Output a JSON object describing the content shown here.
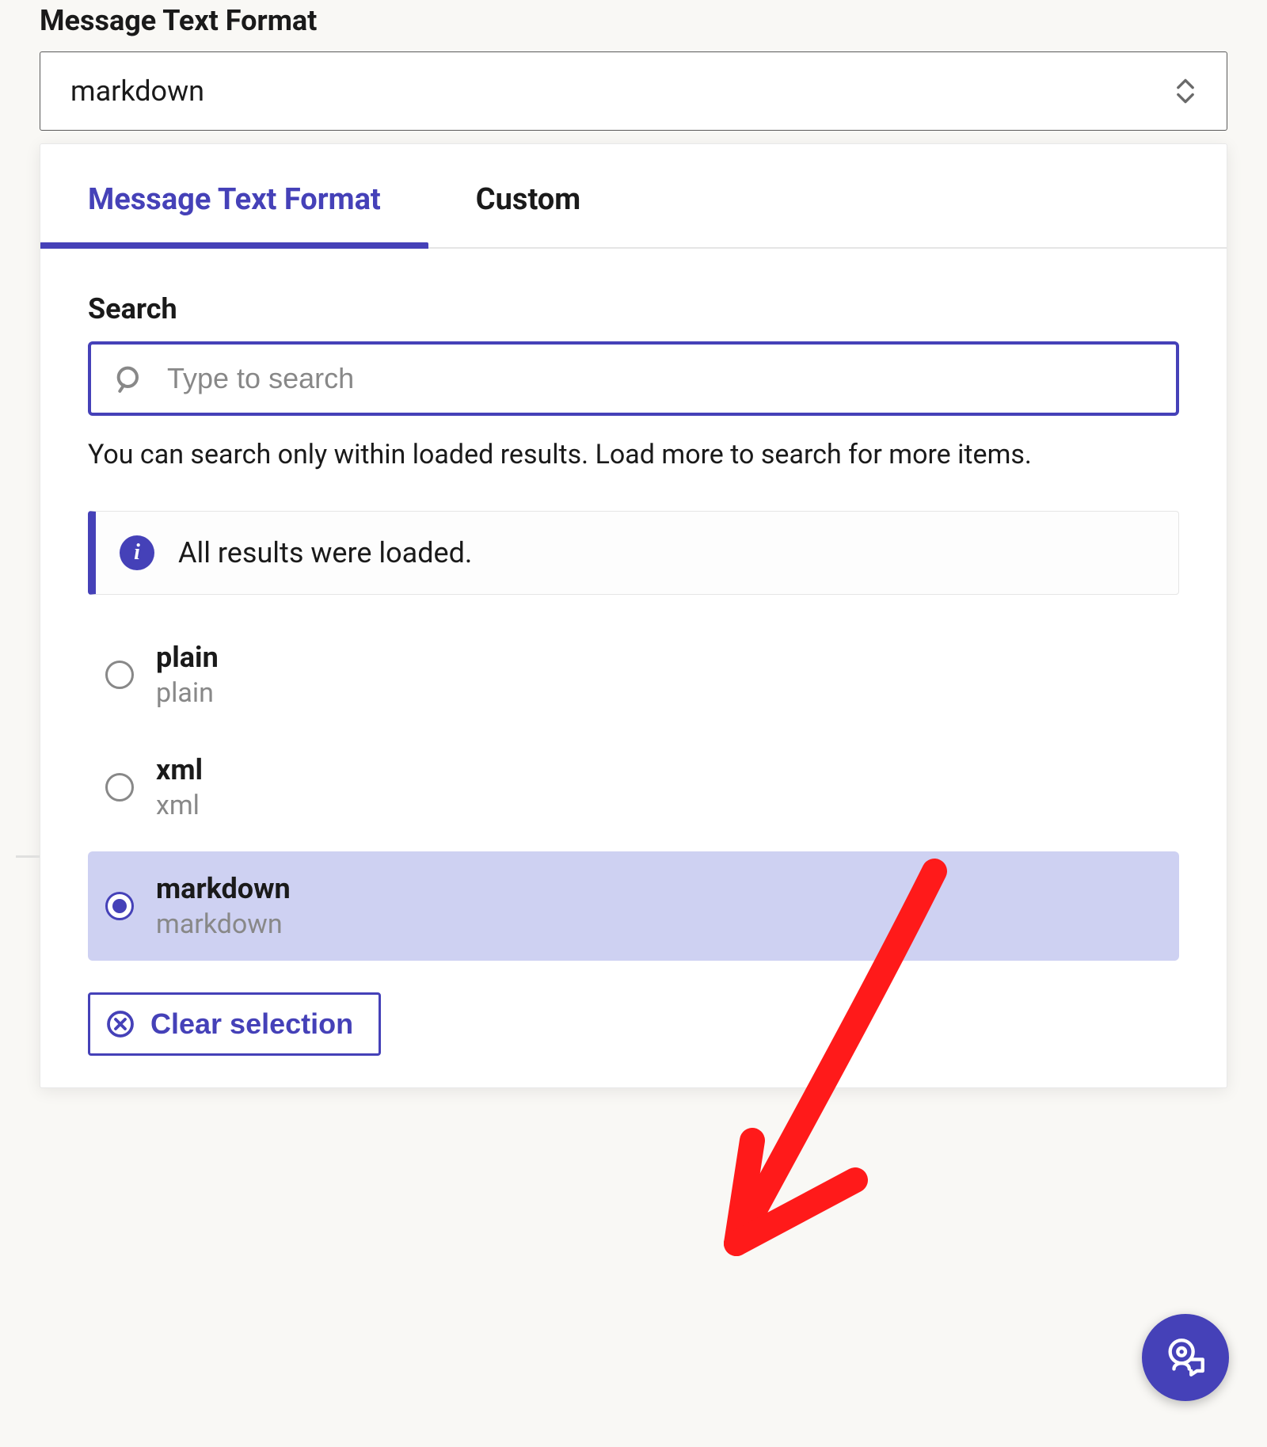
{
  "field": {
    "label": "Message Text Format",
    "selected_value": "markdown"
  },
  "dropdown": {
    "tabs": [
      {
        "label": "Message Text Format",
        "active": true
      },
      {
        "label": "Custom",
        "active": false
      }
    ],
    "search": {
      "label": "Search",
      "placeholder": "Type to search",
      "help": "You can search only within loaded results. Load more to search for more items."
    },
    "notice": "All results were loaded.",
    "options": [
      {
        "title": "plain",
        "sub": "plain",
        "selected": false
      },
      {
        "title": "xml",
        "sub": "xml",
        "selected": false
      },
      {
        "title": "markdown",
        "sub": "markdown",
        "selected": true
      }
    ],
    "clear_label": "Clear selection"
  }
}
